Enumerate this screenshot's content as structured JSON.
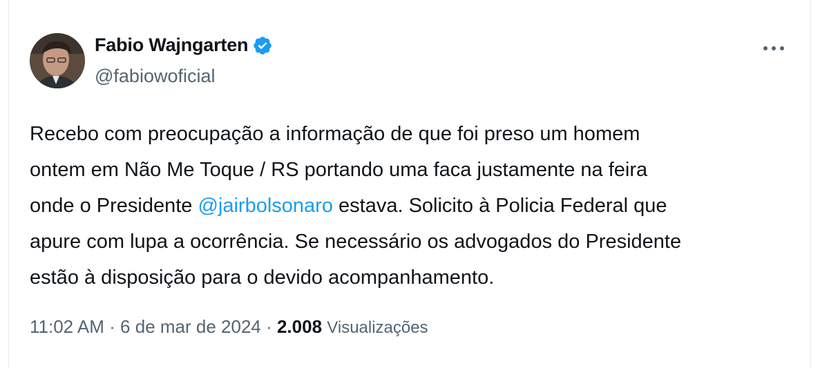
{
  "author": {
    "display_name": "Fabio Wajngarten",
    "handle": "@fabiowoficial",
    "verified": true,
    "verified_color": "#1d9bf0"
  },
  "menu": {
    "icon": "more-horizontal-icon"
  },
  "tweet": {
    "line1": "Recebo com preocupação a informação de que foi preso um homem",
    "line2": "ontem em Não Me Toque / RS portando uma faca justamente na feira",
    "line3_before": "onde o Presidente ",
    "mention": "@jairbolsonaro",
    "line3_after": " estava. Solicito à Policia Federal que",
    "line4": "apure com lupa a ocorrência. Se necessário os advogados do Presidente",
    "line5": "estão à disposição para o devido acompanhamento."
  },
  "meta": {
    "time": "11:02 AM",
    "separator": " · ",
    "date": "6 de mar de 2024",
    "views_count": "2.008",
    "views_label": "Visualizações"
  },
  "colors": {
    "text": "#0f1419",
    "secondary": "#536471",
    "link": "#1d9bf0"
  }
}
